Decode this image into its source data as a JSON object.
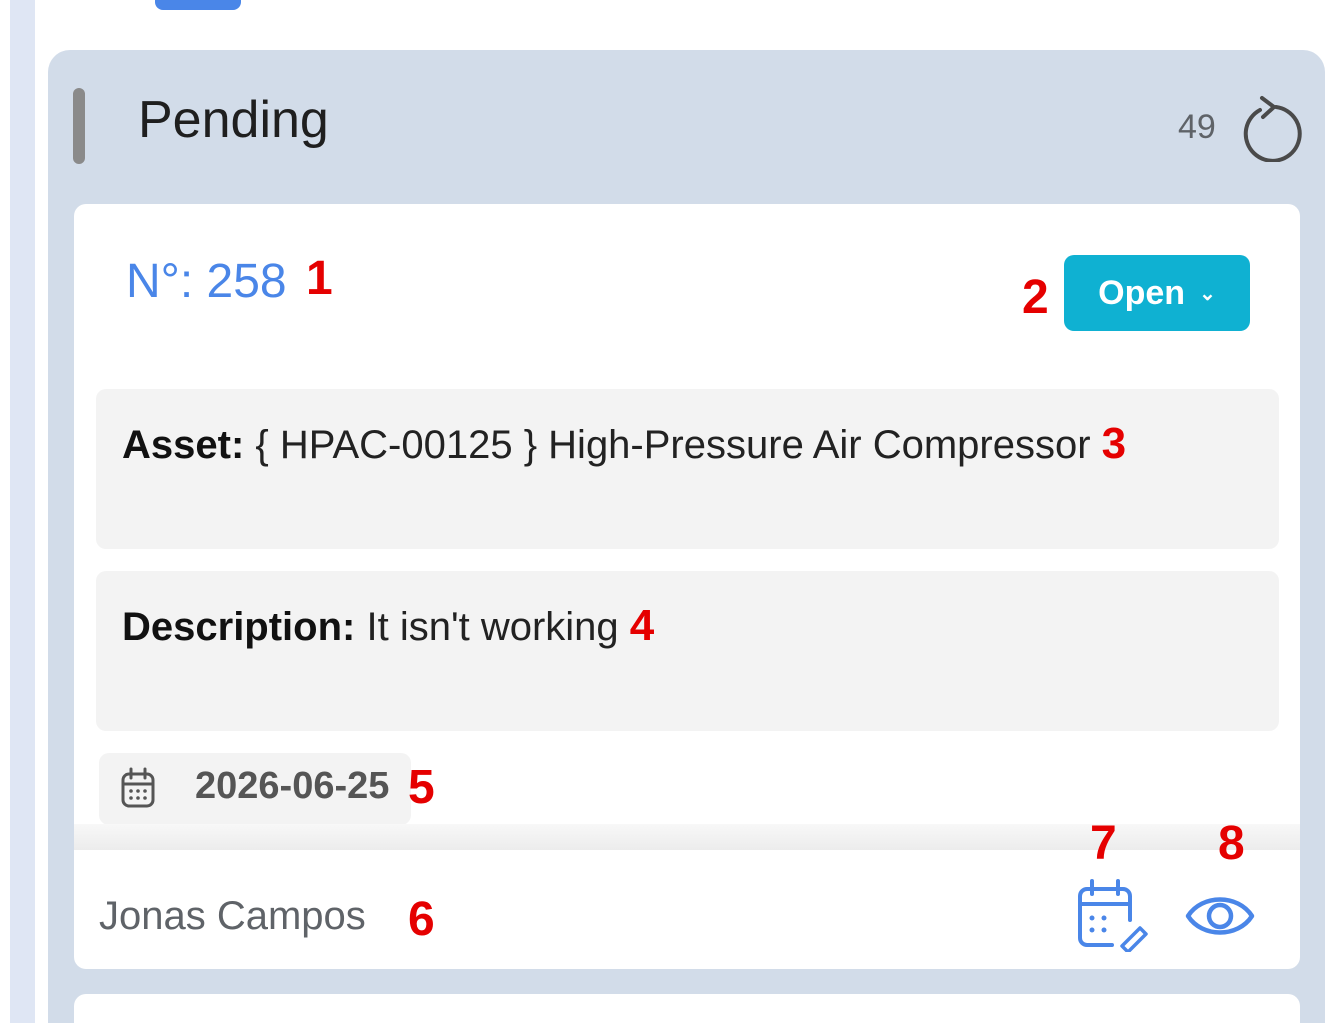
{
  "column": {
    "title": "Pending",
    "count": "49",
    "refresh_icon": "refresh-icon"
  },
  "card": {
    "number_text": "N°: 258",
    "status": "Open",
    "status_chevron": "⌄",
    "asset_label": "Asset:",
    "asset_value": "{ HPAC-00125 } High-Pressure Air Compressor",
    "description_label": "Description:",
    "description_value": "It isn't working",
    "date": "2026-06-25",
    "assignee": "Jonas Campos",
    "schedule_icon": "calendar-edit-icon",
    "view_icon": "eye-icon",
    "date_icon": "calendar-icon"
  },
  "markers": [
    "1",
    "2",
    "3",
    "4",
    "5",
    "6",
    "7",
    "8"
  ],
  "colors": {
    "column_bg": "#d2dce9",
    "accent_blue": "#4a86e8",
    "status_bg": "#0fb1d2",
    "marker_red": "#e50000"
  }
}
